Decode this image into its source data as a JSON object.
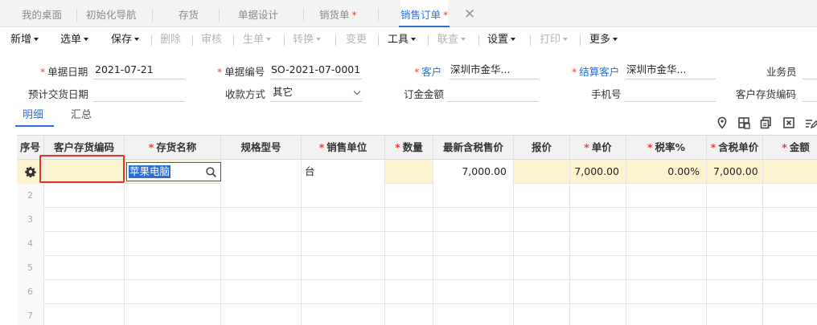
{
  "tabs": [
    {
      "label": "我的桌面",
      "modified": false
    },
    {
      "label": "初始化导航",
      "modified": false
    },
    {
      "label": "存货",
      "modified": false
    },
    {
      "label": "单据设计",
      "modified": false
    },
    {
      "label": "销货单",
      "modified": true
    },
    {
      "label": "销售订单",
      "modified": true,
      "active": true
    }
  ],
  "tab_modified_mark": "*",
  "tab_close_glyph": "✕",
  "toolbar": [
    {
      "label": "新增",
      "dropdown": true,
      "disabled": false
    },
    {
      "label": "选单",
      "dropdown": true,
      "disabled": false
    },
    {
      "label": "保存",
      "dropdown": true,
      "disabled": false
    },
    {
      "label": "删除",
      "dropdown": false,
      "disabled": true
    },
    {
      "label": "审核",
      "dropdown": false,
      "disabled": true
    },
    {
      "label": "生单",
      "dropdown": true,
      "disabled": true
    },
    {
      "label": "转换",
      "dropdown": true,
      "disabled": true
    },
    {
      "label": "变更",
      "dropdown": false,
      "disabled": true
    },
    {
      "label": "工具",
      "dropdown": true,
      "disabled": false
    },
    {
      "label": "联查",
      "dropdown": true,
      "disabled": true
    },
    {
      "label": "设置",
      "dropdown": true,
      "disabled": false
    },
    {
      "label": "打印",
      "dropdown": true,
      "disabled": true
    },
    {
      "label": "更多",
      "dropdown": true,
      "disabled": false
    }
  ],
  "form": {
    "doc_date_label": "单据日期",
    "doc_date_value": "2021-07-21",
    "doc_no_label": "单据编号",
    "doc_no_value": "SO-2021-07-0001",
    "customer_label": "客户",
    "customer_value": "深圳市金华...",
    "settle_customer_label": "结算客户",
    "settle_customer_value": "深圳市金华...",
    "salesperson_label": "业务员",
    "delivery_date_label": "预计交货日期",
    "payment_method_label": "收款方式",
    "payment_method_value": "其它",
    "deposit_label": "订金金额",
    "mobile_label": "手机号",
    "customer_stock_code_label": "客户存货编码",
    "required_mark": "*"
  },
  "subtabs": [
    {
      "label": "明细",
      "active": true
    },
    {
      "label": "汇总",
      "active": false
    }
  ],
  "grid_icons": [
    "location-icon",
    "add-row-icon",
    "copy-row-icon",
    "delete-row-icon",
    "batch-edit-icon"
  ],
  "grid": {
    "columns": [
      {
        "label": "序号",
        "required": false
      },
      {
        "label": "客户存货编码",
        "required": false
      },
      {
        "label": "存货名称",
        "required": true
      },
      {
        "label": "规格型号",
        "required": false
      },
      {
        "label": "销售单位",
        "required": true
      },
      {
        "label": "数量",
        "required": true
      },
      {
        "label": "最新含税售价",
        "required": false
      },
      {
        "label": "报价",
        "required": false
      },
      {
        "label": "单价",
        "required": true
      },
      {
        "label": "税率%",
        "required": true
      },
      {
        "label": "含税单价",
        "required": true
      },
      {
        "label": "金额",
        "required": true
      }
    ],
    "rows": [
      {
        "index": "",
        "customer_code": "",
        "name": "苹果电脑",
        "spec": "",
        "unit": "台",
        "qty": "",
        "latest_price": "7,000.00",
        "quote": "",
        "price": "7,000.00",
        "tax_rate": "0.00%",
        "tax_price": "7,000.00",
        "amount": ""
      },
      {
        "index": "2"
      },
      {
        "index": "3"
      },
      {
        "index": "4"
      },
      {
        "index": "5"
      },
      {
        "index": "6"
      },
      {
        "index": "7"
      }
    ]
  },
  "colors": {
    "accent": "#2a6fd6",
    "required": "#e8423a",
    "selected_row": "#fdf4cf",
    "highlight_box": "#e8332b"
  }
}
